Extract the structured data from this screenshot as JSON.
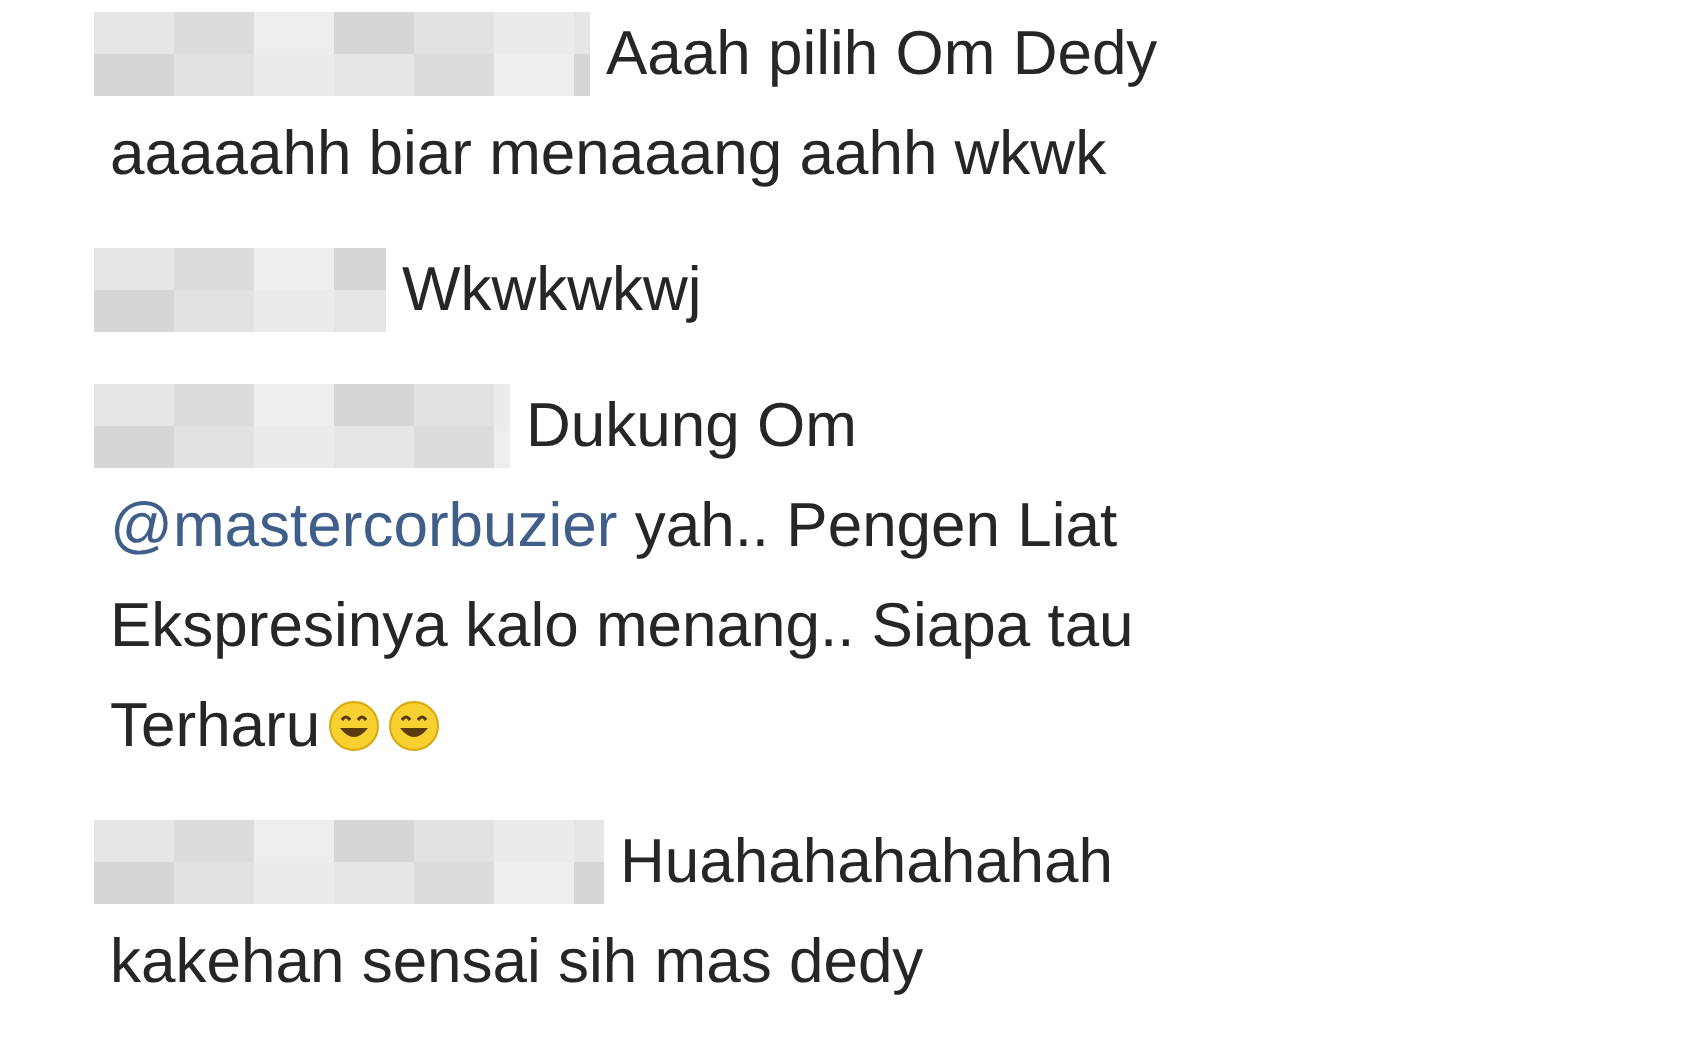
{
  "comments": [
    {
      "lines": [
        [
          {
            "kind": "text",
            "text": "Aaah pilih Om Dedy"
          }
        ],
        [
          {
            "kind": "text",
            "text": "aaaaahh biar menaaang aahh wkwk"
          }
        ]
      ]
    },
    {
      "lines": [
        [
          {
            "kind": "text",
            "text": "Wkwkwkwj"
          }
        ]
      ]
    },
    {
      "lines": [
        [
          {
            "kind": "text",
            "text": "Dukung Om"
          }
        ],
        [
          {
            "kind": "mention",
            "text": "@mastercorbuzier"
          },
          {
            "kind": "text",
            "text": " yah.. Pengen Liat"
          }
        ],
        [
          {
            "kind": "text",
            "text": "Ekspresinya kalo menang.. Siapa tau"
          }
        ],
        [
          {
            "kind": "text",
            "text": "Terharu"
          },
          {
            "kind": "emoji"
          },
          {
            "kind": "emoji"
          }
        ]
      ]
    },
    {
      "lines": [
        [
          {
            "kind": "text",
            "text": "Huahahahahahah"
          }
        ],
        [
          {
            "kind": "text",
            "text": "kakehan sensai sih mas dedy"
          }
        ]
      ]
    }
  ]
}
